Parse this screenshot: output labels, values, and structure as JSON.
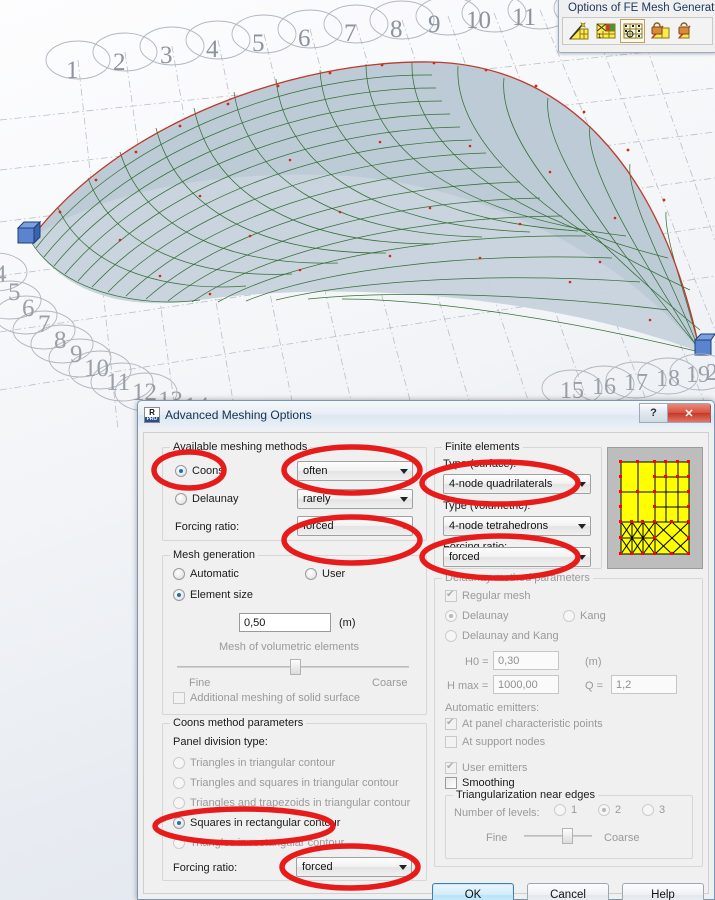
{
  "viewport": {
    "name": "3d-model-viewport",
    "description": "Finite element mesh on a doubly curved shell/dome surface",
    "grid_labels_top": [
      "1",
      "2",
      "3",
      "4",
      "5",
      "6",
      "7",
      "8",
      "9",
      "10",
      "11",
      "12",
      "13",
      "14",
      "15",
      "16"
    ],
    "grid_labels_left": [
      "4",
      "5",
      "6",
      "7",
      "8",
      "9",
      "10",
      "11",
      "12",
      "13",
      "14"
    ],
    "grid_labels_bottom_right": [
      "15",
      "16",
      "17",
      "18",
      "19",
      "2"
    ],
    "mesh_color": "#2d6a2d",
    "node_color": "#d02a12",
    "surface_color": "#c6d2dc",
    "support_color": "#4a78c8"
  },
  "fe_toolbar": {
    "title": "Options of FE Mesh Generation",
    "buttons": [
      {
        "name": "generate-mesh-icon",
        "label": "Mesh generation"
      },
      {
        "name": "mesh-options-icon",
        "label": "Meshing options"
      },
      {
        "name": "mesh-freeze-icon",
        "label": "Local mesh generation",
        "selected": true
      },
      {
        "name": "lock-mesh-icon",
        "label": "Freeze/unfreeze mesh"
      },
      {
        "name": "unlock-mesh-icon",
        "label": "Delete mesh"
      }
    ]
  },
  "dialog": {
    "title": "Advanced Meshing Options",
    "icon_top": "R",
    "icon_bottom": "PRO",
    "help_button": "?",
    "close_button": "✕",
    "available_methods": {
      "legend": "Available meshing methods",
      "coons": {
        "label": "Coons",
        "selected": true
      },
      "delaunay": {
        "label": "Delaunay",
        "selected": false
      },
      "coons_frequency": "often",
      "delaunay_frequency": "rarely",
      "forcing_ratio_label": "Forcing ratio:",
      "forcing_ratio_value": "forced"
    },
    "mesh_generation": {
      "legend": "Mesh generation",
      "automatic": {
        "label": "Automatic",
        "selected": false
      },
      "user": {
        "label": "User",
        "selected": false
      },
      "element_size": {
        "label": "Element size",
        "selected": true
      },
      "element_size_value": "0,50",
      "element_size_unit": "(m)",
      "volumetric_slider_label": "Mesh of volumetric elements",
      "slider_min_label": "Fine",
      "slider_max_label": "Coarse",
      "additional_meshing": {
        "label": "Additional meshing of solid surface",
        "checked": false
      }
    },
    "coons_parameters": {
      "legend": "Coons method parameters",
      "division_label": "Panel division type:",
      "options": [
        {
          "label": "Triangles in triangular contour",
          "selected": false
        },
        {
          "label": "Triangles and squares in triangular contour",
          "selected": false
        },
        {
          "label": "Triangles and trapezoids in triangular contour",
          "selected": false
        },
        {
          "label": "Squares in rectangular contour",
          "selected": true
        },
        {
          "label": "Triangles in rectangular contour",
          "selected": false
        }
      ],
      "forcing_ratio_label": "Forcing ratio:",
      "forcing_ratio_value": "forced"
    },
    "finite_elements": {
      "legend": "Finite elements",
      "type_surface_label": "Type (surface):",
      "type_surface_value": "4-node quadrilaterals",
      "type_volumetric_label": "Type (volumetric):",
      "type_volumetric_value": "4-node tetrahedrons",
      "forcing_ratio_label": "Forcing ratio:",
      "forcing_ratio_value": "forced"
    },
    "delaunay_parameters": {
      "legend": "Delaunay method parameters",
      "regular_mesh": {
        "label": "Regular mesh",
        "checked": true
      },
      "delaunay": {
        "label": "Delaunay",
        "selected": true
      },
      "kang": {
        "label": "Kang",
        "selected": false
      },
      "delaunay_and_kang": {
        "label": "Delaunay and Kang",
        "selected": false
      },
      "h0_label": "H0 =",
      "h0_value": "0,30",
      "h0_unit": "(m)",
      "hmax_label": "H max =",
      "hmax_value": "1000,00",
      "q_label": "Q =",
      "q_value": "1,2",
      "automatic_emitters_label": "Automatic emitters:",
      "at_panel_points": {
        "label": "At panel characteristic points",
        "checked": true
      },
      "at_support_nodes": {
        "label": "At support nodes",
        "checked": false
      },
      "user_emitters": {
        "label": "User emitters",
        "checked": true
      },
      "smoothing": {
        "label": "Smoothing",
        "checked": false
      },
      "triangularization": {
        "legend": "Triangularization near edges",
        "levels_label": "Number of levels:",
        "levels": [
          {
            "label": "1",
            "selected": false
          },
          {
            "label": "2",
            "selected": true
          },
          {
            "label": "3",
            "selected": false
          }
        ],
        "slider_min_label": "Fine",
        "slider_max_label": "Coarse"
      }
    },
    "preview": {
      "name": "mesh-preview-thumbnail",
      "fill_color": "#ffff00",
      "edge_color": "#000000",
      "node_color": "#ff0000"
    },
    "buttons": {
      "ok": "OK",
      "cancel": "Cancel",
      "help": "Help"
    }
  },
  "annotations": {
    "color": "#e81b1b",
    "highlights": [
      "coons-radio",
      "coons-frequency-combo",
      "available-methods-forcing-combo",
      "squares-in-rectangular-contour-radio",
      "coons-forcing-combo",
      "type-surface-combo",
      "finite-elements-forcing-combo"
    ]
  }
}
